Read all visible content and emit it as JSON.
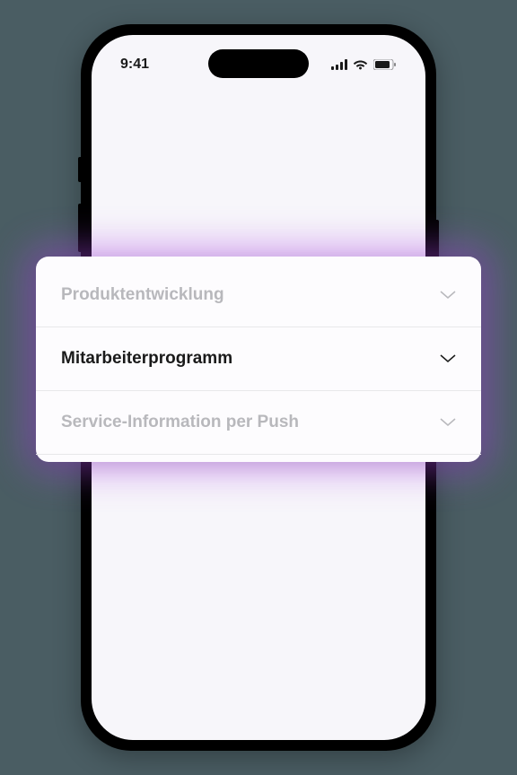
{
  "status": {
    "time": "9:41"
  },
  "list": {
    "items": [
      {
        "label": "Produktentwicklung",
        "active": false
      },
      {
        "label": "Mitarbeiterprogramm",
        "active": true
      },
      {
        "label": "Service-Information per Push",
        "active": false
      }
    ]
  }
}
